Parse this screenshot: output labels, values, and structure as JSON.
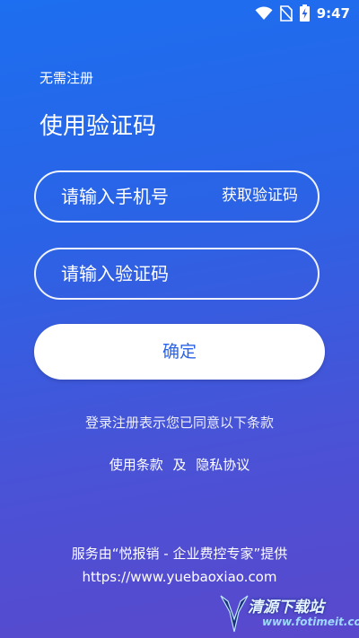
{
  "status_bar": {
    "time": "9:47",
    "icons": [
      "wifi-icon",
      "no-sim-icon",
      "battery-charging-icon"
    ]
  },
  "header": {
    "subtitle": "无需注册",
    "title": "使用验证码"
  },
  "form": {
    "phone_placeholder": "请输入手机号",
    "get_code_label": "获取验证码",
    "code_placeholder": "请输入验证码",
    "confirm_label": "确定"
  },
  "terms": {
    "notice": "登录注册表示您已同意以下条款",
    "usage_terms": "使用条款",
    "and": "及",
    "privacy_policy": "隐私协议"
  },
  "footer": {
    "provider": "服务由“悦报销 - 企业费控专家”提供",
    "url": "https://www.yuebaoxiao.com"
  },
  "watermark": {
    "name": "清源下载站",
    "url": "www.fotimeit.com"
  }
}
